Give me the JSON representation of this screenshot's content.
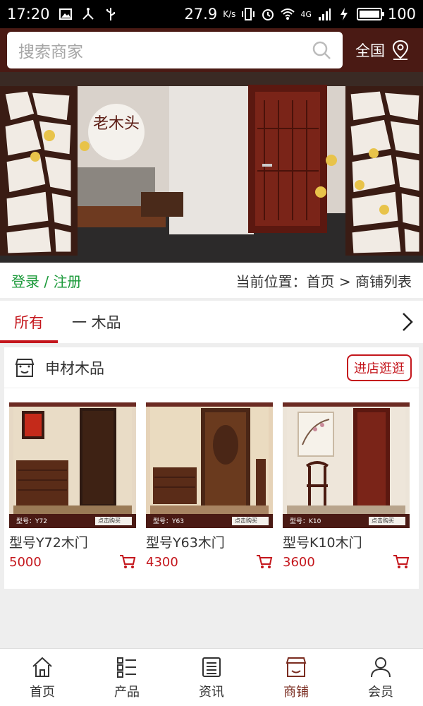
{
  "status_bar": {
    "time": "17:20",
    "speed": "27.9",
    "speed_unit": "K/s",
    "battery": "100",
    "network": "4G"
  },
  "header": {
    "search_placeholder": "搜索商家",
    "region_label": "全国"
  },
  "banner": {
    "brand_text": "老木头"
  },
  "breadcrumb": {
    "login_label": "登录 / 注册",
    "location_label": "当前位置：首页 > 商铺列表"
  },
  "tabs": [
    {
      "label": "所有"
    },
    {
      "label": "一 木品"
    }
  ],
  "shop": {
    "name": "申材木品",
    "visit_label": "进店逛逛",
    "products": [
      {
        "title": "型号Y72木门",
        "price": "5000",
        "model_tag": "型号：Y72",
        "buy_tag": "点击购买"
      },
      {
        "title": "型号Y63木门",
        "price": "4300",
        "model_tag": "型号：Y63",
        "buy_tag": "点击购买"
      },
      {
        "title": "型号K10木门",
        "price": "3600",
        "model_tag": "型号：K10",
        "buy_tag": "点击购买"
      }
    ]
  },
  "bottom_nav": [
    {
      "label": "首页",
      "icon": "home-icon"
    },
    {
      "label": "产品",
      "icon": "list-icon"
    },
    {
      "label": "资讯",
      "icon": "news-icon"
    },
    {
      "label": "商铺",
      "icon": "shop-icon"
    },
    {
      "label": "会员",
      "icon": "user-icon"
    }
  ],
  "colors": {
    "header_bg": "#4a1a14",
    "accent_red": "#c4161c",
    "login_green": "#1b9a3a",
    "nav_active": "#7a2c20"
  }
}
